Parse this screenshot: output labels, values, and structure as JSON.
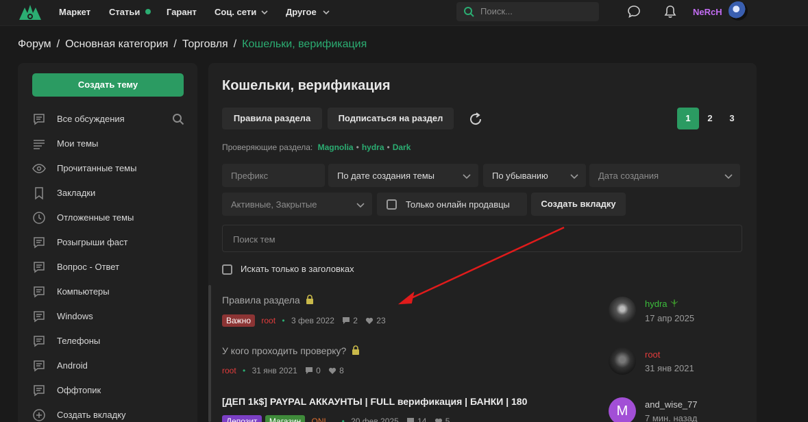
{
  "nav": {
    "items": [
      "Маркет",
      "Статьи",
      "Гарант",
      "Соц. сети",
      "Другое"
    ],
    "search_placeholder": "Поиск...",
    "username": "NeRcH"
  },
  "breadcrumb": [
    "Форум",
    "Основная категория",
    "Торговля",
    "Кошельки, верификация"
  ],
  "sidebar": {
    "create_label": "Создать тему",
    "items": [
      "Все обсуждения",
      "Мои темы",
      "Прочитанные темы",
      "Закладки",
      "Отложенные темы",
      "Розыгрыши фаст",
      "Вопрос - Ответ",
      "Компьютеры",
      "Windows",
      "Телефоны",
      "Android",
      "Оффтопик",
      "Создать вкладку"
    ]
  },
  "main": {
    "title": "Кошельки, верификация",
    "rules_btn": "Правила раздела",
    "subscribe_btn": "Подписаться на раздел",
    "pages": [
      "1",
      "2",
      "3"
    ],
    "mods_label": "Проверяющие раздела:",
    "mods": [
      "Magnolia",
      "hydra",
      "Dark"
    ],
    "filters": {
      "prefix": "Префикс",
      "sort_by": "По дате создания темы",
      "order": "По убыванию",
      "date": "Дата создания",
      "status": "Активные, Закрытые",
      "online_only": "Только онлайн продавцы",
      "create_tab": "Создать вкладку",
      "search_placeholder": "Поиск тем",
      "title_only": "Искать только в заголовках"
    }
  },
  "threads": [
    {
      "title": "Правила раздела",
      "badges": [
        "Важно"
      ],
      "author": "root",
      "date": "3 фев 2022",
      "replies": "2",
      "likes": "23",
      "last_user": "hydra",
      "last_date": "17 апр 2025"
    },
    {
      "title": "У кого проходить проверку?",
      "badges": [],
      "author": "root",
      "date": "31 янв 2021",
      "replies": "0",
      "likes": "8",
      "last_user": "root",
      "last_date": "31 янв 2021"
    },
    {
      "title": "[ДЕП 1k$] PAYPAL АККАУНТЫ | FULL верификация | БАНКИ | 180",
      "badges": [
        "Депозит",
        "Магазин"
      ],
      "author": "ONL...",
      "date": "20 фев 2025",
      "replies": "14",
      "likes": "5",
      "last_user": "and_wise_77",
      "last_avatar_letter": "M",
      "last_date": "7 мин. назад"
    }
  ],
  "colors": {
    "accent": "#2bad72",
    "button_green": "#2b9b62",
    "username": "#c26cf2",
    "author_red": "#e23c3c",
    "badge_important": "#8c3434",
    "badge_deposit": "#7b3fc4",
    "badge_shop": "#3f8b3a",
    "annotation_arrow": "#e01b1b"
  }
}
